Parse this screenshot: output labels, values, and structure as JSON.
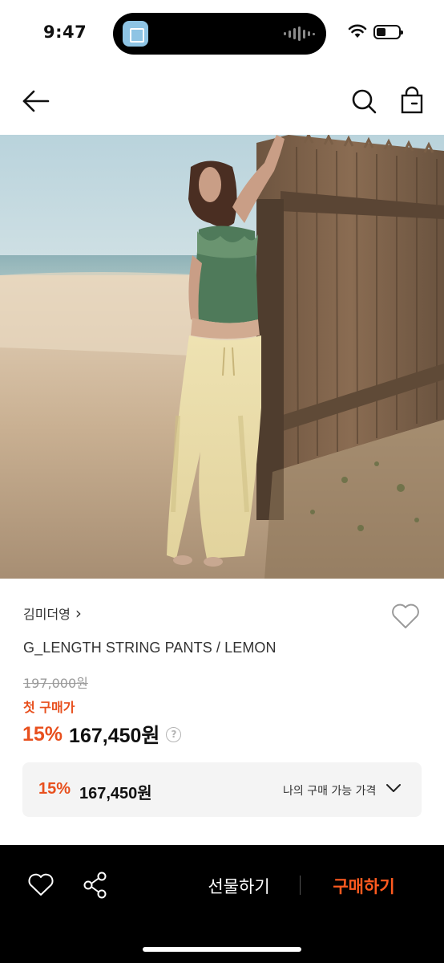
{
  "status_bar": {
    "time": "9:47"
  },
  "icons": {
    "back": "arrow-left-icon",
    "search": "search-icon",
    "bag": "shopping-bag-icon",
    "wishlist": "heart-icon",
    "share": "share-icon",
    "help": "question-circle-icon",
    "expand": "chevron-down-icon"
  },
  "product": {
    "brand": "김미더영",
    "brand_chevron": "›",
    "name": "G_LENGTH STRING PANTS / LEMON",
    "original_price": "197,000원",
    "first_purchase_label": "첫 구매가",
    "discount": "15%",
    "sale_price": "167,450원",
    "help_glyph": "?"
  },
  "price_box": {
    "discount": "15%",
    "price": "167,450원",
    "label": "나의 구매 가능 가격"
  },
  "bottom_bar": {
    "gift_label": "선물하기",
    "buy_label": "구매하기"
  },
  "colors": {
    "accent": "#e8501e",
    "buy_accent": "#ff5a1f",
    "bottom_bar_bg": "#000000",
    "price_box_bg": "#f4f4f4"
  }
}
